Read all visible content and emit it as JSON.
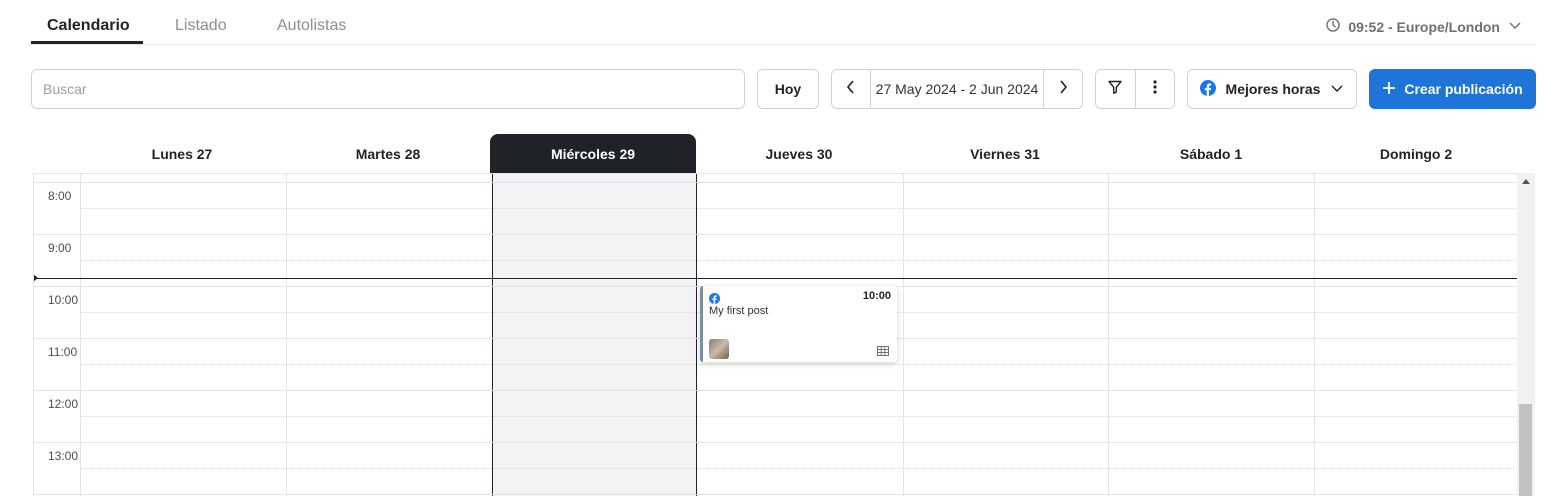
{
  "tabs": [
    {
      "label": "Calendario",
      "active": true
    },
    {
      "label": "Listado",
      "active": false
    },
    {
      "label": "Autolistas",
      "active": false
    }
  ],
  "timezone": {
    "label": "09:52 - Europe/London",
    "icon": "clock-icon"
  },
  "search": {
    "placeholder": "Buscar",
    "value": ""
  },
  "toolbar": {
    "today_label": "Hoy",
    "date_range": "27 May 2024 - 2 Jun 2024",
    "best_hours_label": "Mejores horas",
    "create_label": "Crear publicación"
  },
  "calendar": {
    "days": [
      {
        "label": "Lunes 27",
        "today": false
      },
      {
        "label": "Martes 28",
        "today": false
      },
      {
        "label": "Miércoles 29",
        "today": true
      },
      {
        "label": "Jueves 30",
        "today": false
      },
      {
        "label": "Viernes 31",
        "today": false
      },
      {
        "label": "Sábado 1",
        "today": false
      },
      {
        "label": "Domingo 2",
        "today": false
      }
    ],
    "hours": [
      "8:00",
      "9:00",
      "10:00",
      "11:00",
      "12:00",
      "13:00"
    ],
    "current_time": "09:52",
    "post": {
      "day": "Jueves 30",
      "time": "10:00",
      "text": "My first post",
      "network": "facebook-icon"
    }
  },
  "colors": {
    "accent": "#1e74d8",
    "today_header": "#1f2327",
    "facebook": "#1877f2"
  }
}
